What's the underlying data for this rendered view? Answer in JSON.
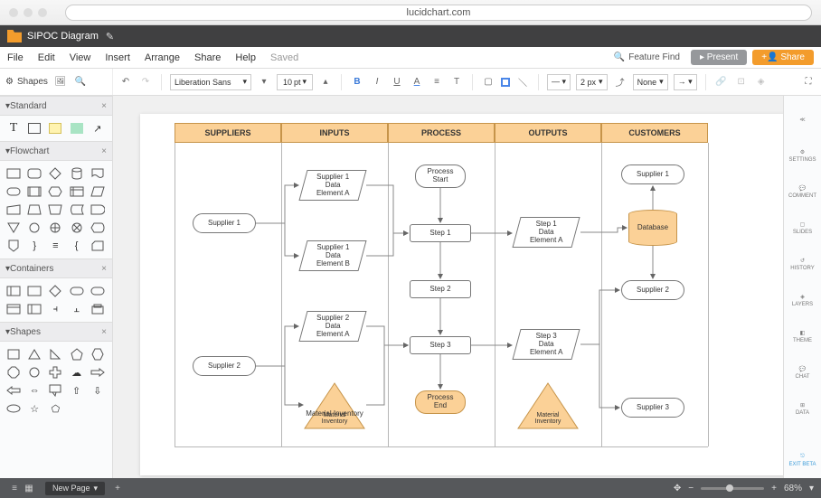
{
  "browser": {
    "url": "lucidchart.com"
  },
  "titlebar": {
    "doc": "SIPOC Diagram"
  },
  "menu": {
    "file": "File",
    "edit": "Edit",
    "view": "View",
    "insert": "Insert",
    "arrange": "Arrange",
    "share": "Share",
    "help": "Help",
    "saved": "Saved",
    "feature_find": "Feature Find",
    "present": "Present",
    "share_btn": "Share"
  },
  "toolbar": {
    "shapes": "Shapes",
    "font": "Liberation Sans",
    "size": "10",
    "unit": "pt",
    "line_w": "2 px",
    "fill": "None"
  },
  "sections": {
    "standard": "Standard",
    "flowchart": "Flowchart",
    "containers": "Containers",
    "shapes": "Shapes"
  },
  "right": {
    "settings": "SETTINGS",
    "comment": "COMMENT",
    "slides": "SLIDES",
    "history": "HISTORY",
    "layers": "LAYERS",
    "theme": "THEME",
    "chat": "CHAT",
    "data": "DATA",
    "exit": "EXIT BETA"
  },
  "status": {
    "page": "New Page",
    "zoom": "68%"
  },
  "diagram": {
    "headers": [
      "SUPPLIERS",
      "INPUTS",
      "PROCESS",
      "OUTPUTS",
      "CUSTOMERS"
    ],
    "supplier1": "Supplier 1",
    "supplier2": "Supplier 2",
    "input1": "Supplier 1\nData\nElement A",
    "input2": "Supplier 1\nData\nElement B",
    "input3": "Supplier 2\nData\nElement A",
    "inventory": "Material\nInventory",
    "pstart": "Process\nStart",
    "step1": "Step 1",
    "step2": "Step 2",
    "step3": "Step 3",
    "pend": "Process\nEnd",
    "out1": "Step 1\nData\nElement A",
    "out3": "Step 3\nData\nElement A",
    "outinv": "Material\nInventory",
    "cust1": "Supplier 1",
    "database": "Database",
    "cust2": "Supplier 2",
    "cust3": "Supplier 3"
  }
}
